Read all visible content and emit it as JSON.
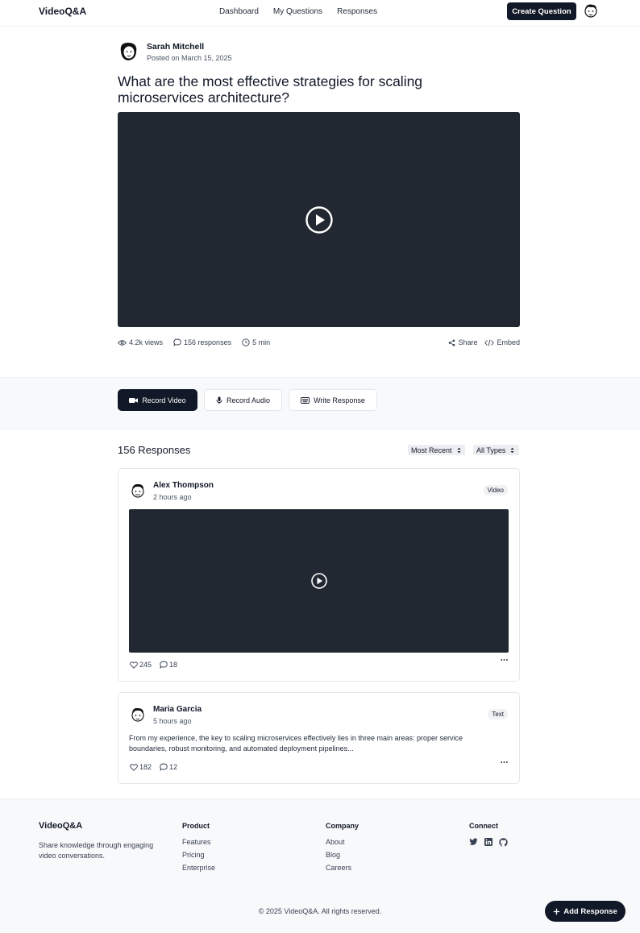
{
  "header": {
    "brand": "VideoQ&A",
    "nav": [
      "Dashboard",
      "My Questions",
      "Responses"
    ],
    "create_label": "Create Question"
  },
  "question": {
    "author": "Sarah Mitchell",
    "posted": "Posted on March 15, 2025",
    "title": "What are the most effective strategies for scaling microservices architecture?",
    "views": "4.2k views",
    "responses": "156 responses",
    "duration": "5 min",
    "share_label": "Share",
    "embed_label": "Embed"
  },
  "actions": {
    "record_video": "Record Video",
    "record_audio": "Record Audio",
    "write_response": "Write Response"
  },
  "responses": {
    "heading": "156 Responses",
    "sort_value": "Most Recent",
    "type_value": "All Types",
    "items": [
      {
        "name": "Alex Thompson",
        "time": "2 hours ago",
        "type": "Video",
        "likes": "245",
        "comments": "18"
      },
      {
        "name": "Maria Garcia",
        "time": "5 hours ago",
        "type": "Text",
        "text": "From my experience, the key to scaling microservices effectively lies in three main areas: proper service boundaries, robust monitoring, and automated deployment pipelines...",
        "likes": "182",
        "comments": "12"
      }
    ]
  },
  "footer": {
    "brand": "VideoQ&A",
    "description": "Share knowledge through engaging video conversations.",
    "product": {
      "title": "Product",
      "links": [
        "Features",
        "Pricing",
        "Enterprise"
      ]
    },
    "company": {
      "title": "Company",
      "links": [
        "About",
        "Blog",
        "Careers"
      ]
    },
    "connect": {
      "title": "Connect",
      "icons": [
        "twitter-icon",
        "linkedin-icon",
        "github-icon"
      ]
    },
    "copyright": "© 2025 VideoQ&A. All rights reserved."
  },
  "fab_label": "Add Response",
  "colors": {
    "dark": "#111827",
    "video_bg": "#222832",
    "band_bg": "#f8f9fb"
  }
}
